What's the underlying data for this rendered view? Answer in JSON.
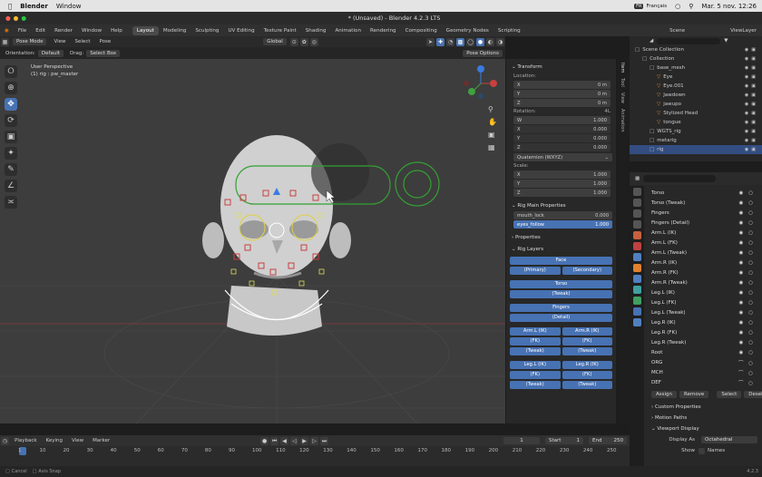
{
  "macbar": {
    "app": "Blender",
    "menu": [
      "Window"
    ],
    "lang": "Français",
    "datetime": "Mar. 5 nov.  12:26"
  },
  "title": "* (Unsaved) - Blender 4.2.3 LTS",
  "menubar": {
    "menus": [
      "File",
      "Edit",
      "Render",
      "Window",
      "Help"
    ],
    "workspaces": [
      "Layout",
      "Modeling",
      "Sculpting",
      "UV Editing",
      "Texture Paint",
      "Shading",
      "Animation",
      "Rendering",
      "Compositing",
      "Geometry Nodes",
      "Scripting"
    ],
    "active": "Layout",
    "scene": "Scene",
    "viewlayer": "ViewLayer"
  },
  "viewport_header": {
    "mode": "Pose Mode",
    "menus": [
      "View",
      "Select",
      "Pose"
    ],
    "orientation": "Global",
    "pose_options": "Pose Options",
    "orientation_label": "Orientation:",
    "orientation_value": "Default",
    "drag_label": "Drag:",
    "drag_value": "Select Box"
  },
  "viewport_info": {
    "line1": "User Perspective",
    "line2": "(1) rig : pw_master"
  },
  "npanel": {
    "transform": "Transform",
    "location": "Location:",
    "loc": [
      {
        "axis": "X",
        "val": "0 m"
      },
      {
        "axis": "Y",
        "val": "0 m"
      },
      {
        "axis": "Z",
        "val": "0 m"
      }
    ],
    "rotation": "Rotation:",
    "rot_mode": "4L",
    "rot": [
      {
        "axis": "W",
        "val": "1.000"
      },
      {
        "axis": "X",
        "val": "0.000"
      },
      {
        "axis": "Y",
        "val": "0.000"
      },
      {
        "axis": "Z",
        "val": "0.000"
      }
    ],
    "quat": "Quaternion (WXYZ)",
    "scale": "Scale:",
    "scl": [
      {
        "axis": "X",
        "val": "1.000"
      },
      {
        "axis": "Y",
        "val": "1.000"
      },
      {
        "axis": "Z",
        "val": "1.000"
      }
    ],
    "rig_main": "Rig Main Properties",
    "mouth_lock": "mouth_lock",
    "mouth_val": "0.000",
    "eyes_follow": "eyes_follow",
    "eyes_val": "1.000",
    "properties": "Properties",
    "rig_layers": "Rig Layers",
    "face": "Face",
    "primary": "(Primary)",
    "secondary": "(Secondary)",
    "torso": "Torso",
    "torso_tweak": "(Tweak)",
    "fingers": "Fingers",
    "fingers_detail": "(Detail)",
    "arm_l_ik": "Arm.L (IK)",
    "arm_r_ik": "Arm.R (IK)",
    "fk": "(FK)",
    "tweak": "(Tweak)",
    "leg_l_ik": "Leg.L (IK)",
    "leg_r_ik": "Leg.R (IK)"
  },
  "vtabs": [
    "Item",
    "Tool",
    "View",
    "Animation"
  ],
  "outliner": {
    "items": [
      {
        "name": "Scene Collection",
        "indent": 0
      },
      {
        "name": "Collection",
        "indent": 1
      },
      {
        "name": "base_mesh",
        "indent": 2
      },
      {
        "name": "Eye",
        "indent": 3
      },
      {
        "name": "Eye.001",
        "indent": 3
      },
      {
        "name": "Jawdown",
        "indent": 3
      },
      {
        "name": "jawupo",
        "indent": 3
      },
      {
        "name": "Stylized Head",
        "indent": 3
      },
      {
        "name": "tongue",
        "indent": 3
      },
      {
        "name": "WGTS_rig",
        "indent": 2
      },
      {
        "name": "metarig",
        "indent": 2
      },
      {
        "name": "rig",
        "indent": 2
      }
    ],
    "selected": "rig"
  },
  "props": {
    "layers": [
      "Torso",
      "Torso (Tweak)",
      "Fingers",
      "Fingers (Detail)",
      "Arm.L (IK)",
      "Arm.L (FK)",
      "Arm.L (Tweak)",
      "Arm.R (IK)",
      "Arm.R (FK)",
      "Arm.R (Tweak)",
      "Leg.L (IK)",
      "Leg.L (FK)",
      "Leg.L (Tweak)",
      "Leg.R (IK)",
      "Leg.R (FK)",
      "Leg.R (Tweak)",
      "Root",
      "ORG",
      "MCH",
      "DEF"
    ],
    "assign": "Assign",
    "remove": "Remove",
    "select": "Select",
    "deselect": "Deselect",
    "custom": "Custom Properties",
    "motion": "Motion Paths",
    "viewport_display": "Viewport Display",
    "display_as": "Display As",
    "display_val": "Octahedral",
    "show": "Show",
    "names": "Names"
  },
  "timeline": {
    "menus": [
      "Playback",
      "Keying",
      "View",
      "Marker"
    ],
    "current": "1",
    "start_label": "Start",
    "start": "1",
    "end_label": "End",
    "end": "250",
    "frames": [
      "1",
      "10",
      "20",
      "30",
      "40",
      "50",
      "60",
      "70",
      "80",
      "90",
      "100",
      "110",
      "120",
      "130",
      "140",
      "150",
      "160",
      "170",
      "180",
      "190",
      "200",
      "210",
      "220",
      "230",
      "240",
      "250"
    ]
  },
  "status": {
    "left": "Cancel",
    "mid": "Axis Snap",
    "version": "4.2.3"
  }
}
